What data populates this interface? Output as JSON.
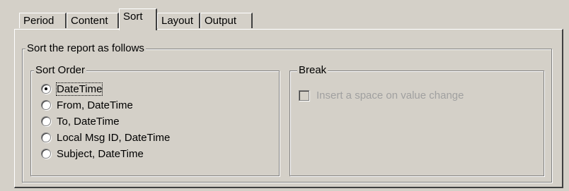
{
  "tabs": [
    {
      "label": "Period"
    },
    {
      "label": "Content"
    },
    {
      "label": "Sort"
    },
    {
      "label": "Layout"
    },
    {
      "label": "Output"
    }
  ],
  "active_tab": "Sort",
  "sort_group": {
    "legend": "Sort the report as follows"
  },
  "sort_order": {
    "legend": "Sort Order",
    "options": [
      {
        "label": "DateTime",
        "selected": true
      },
      {
        "label": "From, DateTime",
        "selected": false
      },
      {
        "label": "To, DateTime",
        "selected": false
      },
      {
        "label": "Local Msg ID, DateTime",
        "selected": false
      },
      {
        "label": "Subject, DateTime",
        "selected": false
      }
    ]
  },
  "break": {
    "legend": "Break",
    "insert_space_label": "Insert a space on value change",
    "insert_space_checked": false,
    "insert_space_enabled": false
  }
}
